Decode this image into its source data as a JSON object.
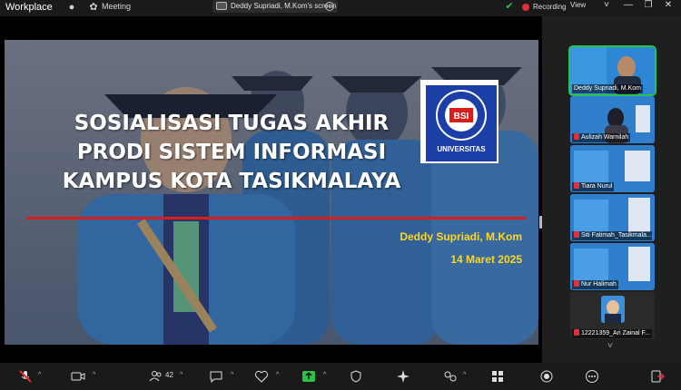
{
  "window": {
    "app_title": "Workplace",
    "meeting_label": "Meeting",
    "screen_share_label": "Deddy Supriadi, M.Kom's screen",
    "recording_label": "Recording",
    "view_label": "View"
  },
  "slide": {
    "title_lines": [
      "SOSIALISASI TUGAS AKHIR",
      "PRODI SISTEM INFORMASI",
      "KAMPUS KOTA TASIKMALAYA"
    ],
    "presenter": "Deddy Supriadi, M.Kom",
    "date": "14 Maret 2025",
    "logo_text": "UNIVERSITAS",
    "logo_ring_text": "BINA SARANA INFORMATIKA",
    "logo_initials": "BSI"
  },
  "participants": [
    {
      "name": "Deddy Supriadi, M.Kom",
      "muted": false,
      "active": true
    },
    {
      "name": "Aulizah Warnilah",
      "muted": true,
      "active": false
    },
    {
      "name": "Tiara Nurul",
      "muted": true,
      "active": false
    },
    {
      "name": "Siti Fatimah_Tasikmala...",
      "muted": true,
      "active": false
    },
    {
      "name": "Nur Halimah",
      "muted": true,
      "active": false
    },
    {
      "name": "12221359_Ari Zainal F...",
      "muted": true,
      "active": false
    }
  ],
  "toolbar": {
    "participant_count": "42"
  },
  "colors": {
    "accent_green": "#27c34a",
    "record_red": "#e0303b",
    "slide_title": "#ffffff",
    "slide_subtitle": "#ffd71e",
    "slide_rule": "#d91c1c"
  }
}
